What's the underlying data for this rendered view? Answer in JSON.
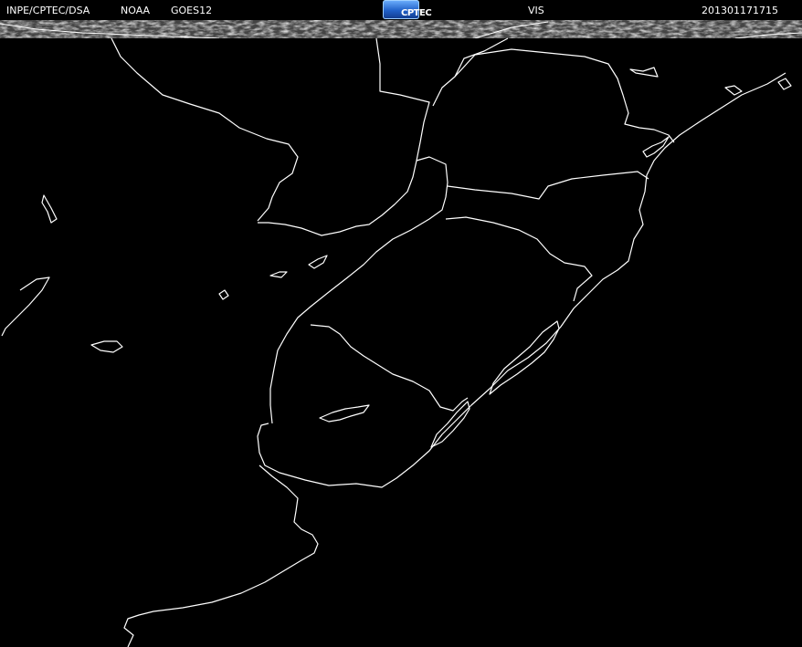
{
  "header": {
    "agency": "INPE/CPTEC/DSA",
    "satellite_org": "NOAA",
    "satellite": "GOES12",
    "logo_text": "CPTEC",
    "channel": "VIS",
    "timestamp": "201301171715"
  },
  "colors": {
    "background": "#000000",
    "borders": "#ffffff",
    "header_text": "#ffffff",
    "logo_blue": "#2060c8"
  },
  "image": {
    "type": "satellite visible-channel image with coastline and political boundary overlay",
    "cloud_band": "thin band of gray cloud texture along the top edge"
  }
}
